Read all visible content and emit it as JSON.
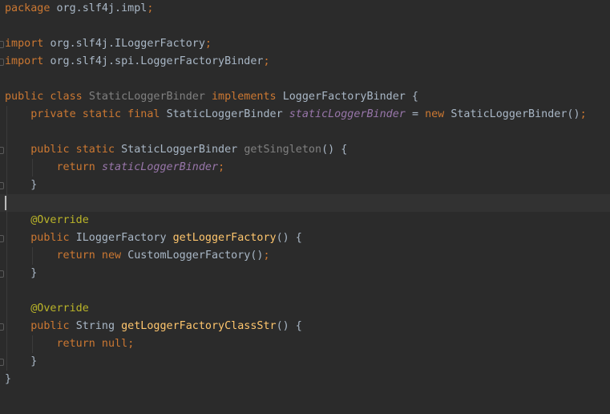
{
  "code": {
    "l1": {
      "kw": "package",
      "rest": "org.slf4j.impl",
      "semi": ";"
    },
    "l3": {
      "kw": "import",
      "rest": "org.slf4j.ILoggerFactory",
      "semi": ";"
    },
    "l4": {
      "kw": "import",
      "rest": "org.slf4j.spi.LoggerFactoryBinder",
      "semi": ";"
    },
    "l6": {
      "kw1": "public class",
      "name": "StaticLoggerBinder",
      "kw2": "implements",
      "rest": "LoggerFactoryBinder {"
    },
    "l7": {
      "kw": "private static final",
      "type": "StaticLoggerBinder",
      "field": "staticLoggerBinder",
      "eq": "=",
      "kw2": "new",
      "call": "StaticLoggerBinder()",
      "semi": ";"
    },
    "l9": {
      "kw": "public static",
      "type": "StaticLoggerBinder",
      "fn": "getSingleton",
      "rest": "() {"
    },
    "l10": {
      "kw": "return",
      "field": "staticLoggerBinder",
      "semi": ";"
    },
    "l11": {
      "rest": "}"
    },
    "l13": {
      "annot": "@Override"
    },
    "l14": {
      "kw": "public",
      "type": "ILoggerFactory",
      "fn": "getLoggerFactory",
      "rest": "() {"
    },
    "l15": {
      "kw": "return new",
      "call": "CustomLoggerFactory()",
      "semi": ";"
    },
    "l16": {
      "rest": "}"
    },
    "l18": {
      "annot": "@Override"
    },
    "l19": {
      "kw": "public",
      "type": "String",
      "fn": "getLoggerFactoryClassStr",
      "rest": "() {"
    },
    "l20": {
      "kw": "return null",
      "semi": ";"
    },
    "l21": {
      "rest": "}"
    },
    "l22": {
      "rest": "}"
    }
  }
}
